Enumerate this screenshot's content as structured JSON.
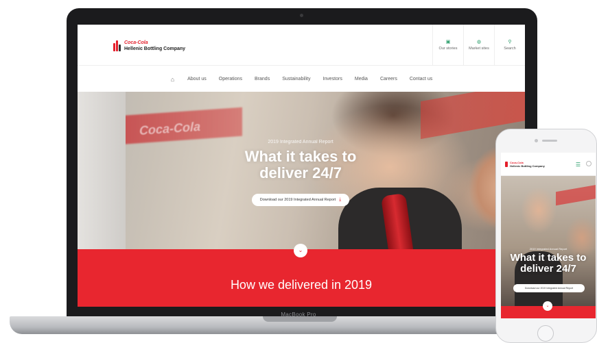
{
  "laptop": {
    "label": "MacBook Pro"
  },
  "site": {
    "brand": {
      "line1": "Coca-Cola",
      "line2": "Hellenic Bottling Company"
    },
    "utility": [
      {
        "icon": "stories-icon",
        "glyph": "▣",
        "label": "Our stories"
      },
      {
        "icon": "markets-icon",
        "glyph": "◍",
        "label": "Market sites"
      },
      {
        "icon": "search-icon",
        "glyph": "⚲",
        "label": "Search"
      }
    ],
    "nav": {
      "home_glyph": "⌂",
      "items": [
        "About us",
        "Operations",
        "Brands",
        "Sustainability",
        "Investors",
        "Media",
        "Careers",
        "Contact us"
      ]
    },
    "hero": {
      "sign_text": "Coca-Cola",
      "kicker": "2019 Integrated Annual Report",
      "title": "What it takes to deliver 24/7",
      "button": "Download our 2019 Integrated Annual Report",
      "button_glyph": "⤓"
    },
    "scroll_glyph": "⌄",
    "band_title": "How we delivered in 2019"
  },
  "phone": {
    "brand": {
      "line1": "Coca-Cola",
      "line2": "Hellenic Bottling Company"
    },
    "menu_glyph": "☰",
    "hero": {
      "kicker": "2019 Integrated Annual Report",
      "title": "What it takes to deliver 24/7",
      "button": "Download our 2019 Integrated Annual Report"
    },
    "scroll_glyph": "⌄"
  },
  "colors": {
    "brand_red": "#e8262f",
    "accent_green": "#2a9d6a"
  }
}
